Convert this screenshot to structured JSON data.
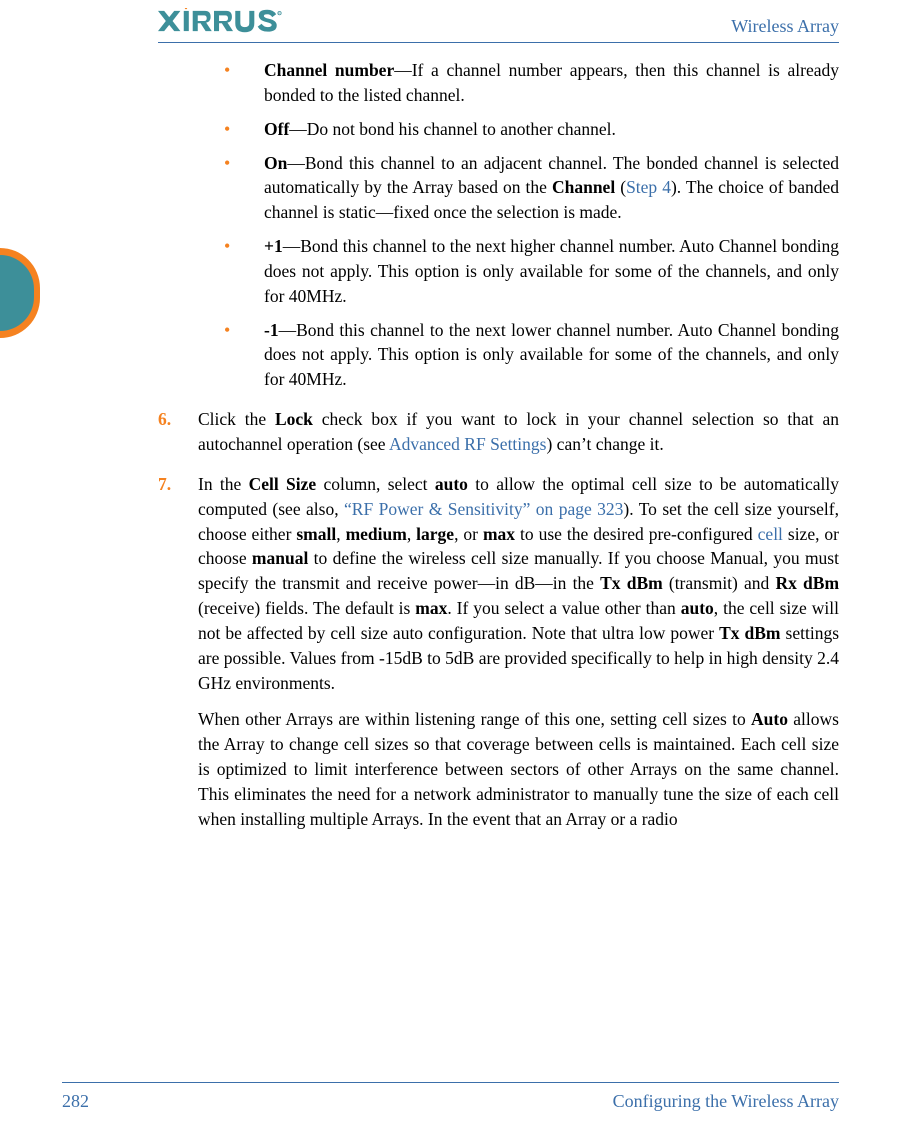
{
  "header": {
    "doc_title": "Wireless Array",
    "logo_alt": "XIRRUS"
  },
  "bullets": [
    {
      "term": "Channel number",
      "text_parts": [
        "—If a channel number appears, then this channel is already bonded to the listed channel."
      ]
    },
    {
      "term": "Off",
      "text_parts": [
        "—Do not bond his channel to another channel."
      ]
    },
    {
      "term": "On",
      "pre": "—Bond this channel to an adjacent channel. The bonded channel is selected automatically by the Array based on the ",
      "bold": "Channel",
      "mid": " (",
      "link": "Step 4",
      "post": "). The choice of banded channel is static—fixed once the selection is made."
    },
    {
      "term": "+1",
      "text_parts": [
        "—Bond this channel to the next higher channel number. Auto Channel bonding does not apply. This option is only available for some of the channels, and only for 40MHz."
      ]
    },
    {
      "term": "-1",
      "text_parts": [
        "—Bond this channel to the next lower channel number. Auto Channel bonding does not apply. This option is only available for some of the channels, and only for 40MHz."
      ]
    }
  ],
  "step6": {
    "num": "6.",
    "pre": "Click the ",
    "b1": "Lock",
    "mid": " check box if you want to lock in your channel selection so that an autochannel operation (see ",
    "link": "Advanced RF Settings",
    "post": ") can’t change it."
  },
  "step7": {
    "num": "7.",
    "t1": "In the ",
    "b_cellsize": "Cell Size",
    "t2": " column, select ",
    "b_auto": "auto",
    "t3": " to allow the optimal cell size to be automatically computed (see also, ",
    "link_rf": "“RF Power & Sensitivity” on page 323",
    "t4": "). To set the cell size yourself, choose either ",
    "b_small": "small",
    "t5": ", ",
    "b_medium": "medium",
    "t6": ", ",
    "b_large": "large",
    "t7": ", or ",
    "b_max": "max",
    "t8": " to use the desired pre-configured ",
    "link_cell": "cell",
    "t9": " size, or choose ",
    "b_manual": "manual",
    "t10": " to define the wireless cell size manually. If you choose Manual, you must specify the transmit and receive power—in dB—in the ",
    "b_tx": "Tx dBm",
    "t11": " (transmit) and ",
    "b_rx": "Rx dBm",
    "t12": " (receive) fields. The default is ",
    "b_max2": "max",
    "t13": ". If you select a value other than ",
    "b_auto2": "auto",
    "t14": ", the cell size will not be affected by cell size auto configuration. Note that ultra low power ",
    "b_tx2": "Tx dBm",
    "t15": " settings are possible. Values from -15dB to 5dB are provided specifically to help in high density 2.4 GHz environments."
  },
  "step7_p2": {
    "t1": "When other Arrays are within listening range of this one, setting cell sizes to ",
    "b_auto": "Auto",
    "t2": " allows the Array to change cell sizes so that coverage between cells is maintained. Each cell size is optimized to limit interference between sectors of other Arrays on the same channel. This eliminates the need for a network administrator to manually tune the size of each cell when installing multiple Arrays. In the event that an Array or a radio"
  },
  "footer": {
    "page": "282",
    "section": "Configuring the Wireless Array"
  }
}
